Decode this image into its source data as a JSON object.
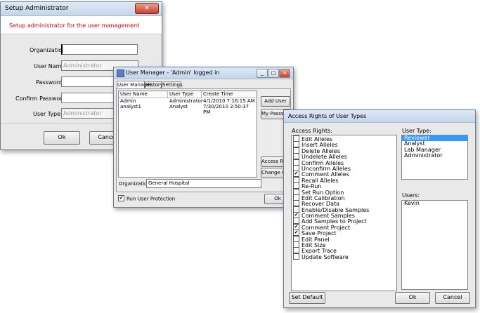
{
  "setup_admin": {
    "title": "Setup Administrator",
    "close_glyph": "✕",
    "subtitle": "Setup administrator for the user management",
    "labels": {
      "organization": "Organization:",
      "user_name": "User Name:",
      "password": "Password:",
      "confirm_password": "Confirm Password:",
      "user_type": "User Type:"
    },
    "values": {
      "organization": "",
      "user_name": "Administrator",
      "password": "",
      "confirm_password": "",
      "user_type": "Administrator"
    },
    "ok": "Ok",
    "cancel": "Cancel"
  },
  "user_manager": {
    "title": "User Manager - 'Admin' logged in",
    "tabs": [
      "User Manager",
      "History",
      "Settings"
    ],
    "columns": [
      "User Name",
      "User Type",
      "Create Time"
    ],
    "rows": [
      [
        "Admin",
        "Administrator",
        "4/1/2010 7:16:15 AM"
      ],
      [
        "analyst1",
        "Analyst",
        "7/30/2010 2:50:37 PM"
      ]
    ],
    "buttons": {
      "add_user": "Add User",
      "my_password": "My Password",
      "access_rights": "Access Rights",
      "change_user": "Change User",
      "ok": "Ok"
    },
    "organization_label": "Organization:",
    "organization_value": "General Hospital",
    "run_user_protection": "Run User Protection",
    "run_user_protection_checked": true,
    "window_glyphs": [
      "_",
      "□",
      "✕"
    ]
  },
  "access_rights": {
    "title": "Access Rights of User Types",
    "rights_label": "Access Rights:",
    "rights": [
      {
        "label": "Edit Alleles",
        "checked": false
      },
      {
        "label": "Insert Alleles",
        "checked": false
      },
      {
        "label": "Delete Alleles",
        "checked": false
      },
      {
        "label": "Undelete Alleles",
        "checked": false
      },
      {
        "label": "Confirm Alleles",
        "checked": false
      },
      {
        "label": "Unconfirm Alleles",
        "checked": false
      },
      {
        "label": "Comment Alleles",
        "checked": true
      },
      {
        "label": "Recall Alleles",
        "checked": false
      },
      {
        "label": "Re-Run",
        "checked": false
      },
      {
        "label": "Set Run Option",
        "checked": false
      },
      {
        "label": "Edit Calibration",
        "checked": false
      },
      {
        "label": "Recover Data",
        "checked": false
      },
      {
        "label": "Enable/Disable Samples",
        "checked": false
      },
      {
        "label": "Comment Samples",
        "checked": true
      },
      {
        "label": "Add Samples to Project",
        "checked": false
      },
      {
        "label": "Comment Project",
        "checked": true
      },
      {
        "label": "Save Project",
        "checked": true
      },
      {
        "label": "Edit Panel",
        "checked": false
      },
      {
        "label": "Edit Size",
        "checked": false
      },
      {
        "label": "Export Trace",
        "checked": false
      },
      {
        "label": "Update Software",
        "checked": false
      }
    ],
    "user_type_label": "User Type:",
    "user_types": [
      "Reviewer",
      "Analyst",
      "Lab Manager",
      "Administrator"
    ],
    "selected_user_type": "Reviewer",
    "users_label": "Users:",
    "users": [
      "Kevin"
    ],
    "set_default": "Set Default",
    "ok": "Ok",
    "cancel": "Cancel",
    "check_glyph": "✔",
    "selection_color": "#3399ff"
  },
  "colors": {
    "subtitle_red": "#e00000",
    "title_gradient_top": "#dfe9f5",
    "close_red": "#c5412a"
  }
}
